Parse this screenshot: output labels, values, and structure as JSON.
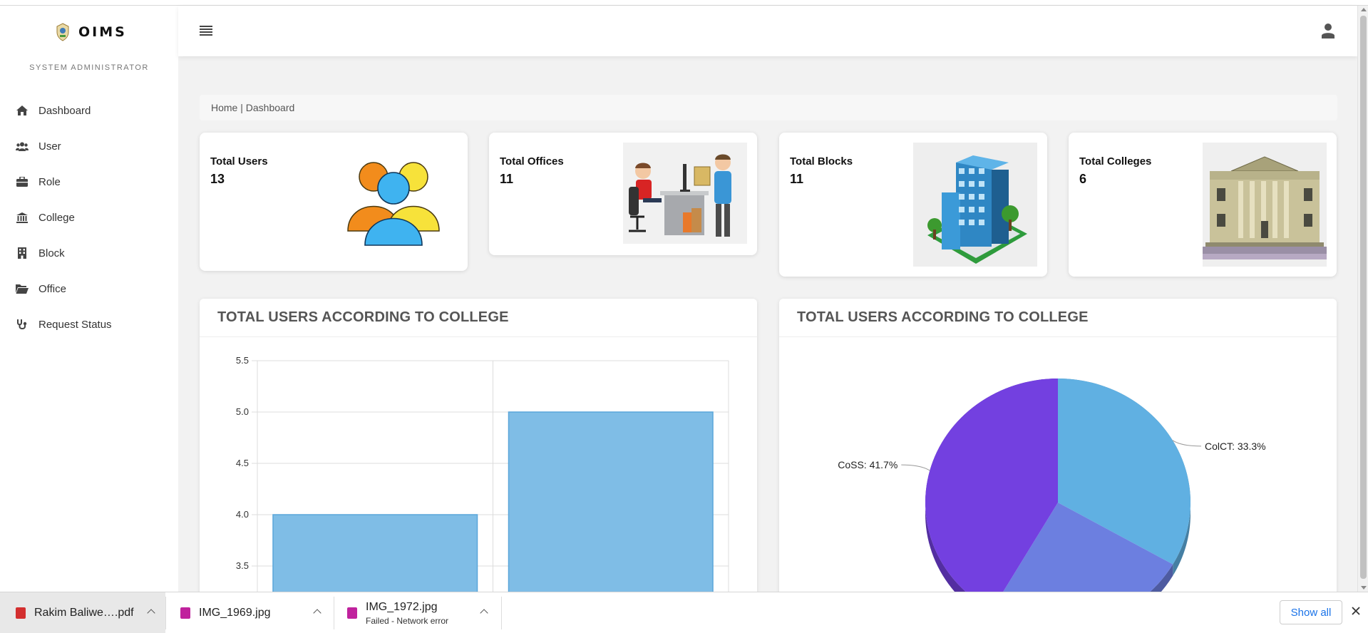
{
  "app": {
    "brand": "OIMS",
    "role_caption": "SYSTEM ADMINISTRATOR"
  },
  "sidebar": {
    "items": [
      {
        "label": "Dashboard",
        "icon": "home-icon"
      },
      {
        "label": "User",
        "icon": "users-icon"
      },
      {
        "label": "Role",
        "icon": "briefcase-icon"
      },
      {
        "label": "College",
        "icon": "bank-icon"
      },
      {
        "label": "Block",
        "icon": "building-icon"
      },
      {
        "label": "Office",
        "icon": "folder-open-icon"
      },
      {
        "label": "Request Status",
        "icon": "stethoscope-icon"
      }
    ]
  },
  "breadcrumb": {
    "home": "Home",
    "separator": " | ",
    "current": "Dashboard"
  },
  "stats": [
    {
      "title": "Total Users",
      "value": "13",
      "image": "users-group-illustration"
    },
    {
      "title": "Total Offices",
      "value": "11",
      "image": "office-workers-illustration"
    },
    {
      "title": "Total Blocks",
      "value": "11",
      "image": "building-block-illustration"
    },
    {
      "title": "Total Colleges",
      "value": "6",
      "image": "college-building-illustration"
    }
  ],
  "panels": {
    "bar_title": "TOTAL USERS ACCORDING TO COLLEGE",
    "pie_title": "TOTAL USERS ACCORDING TO COLLEGE"
  },
  "chart_data": [
    {
      "type": "bar",
      "title": "TOTAL USERS ACCORDING TO COLLEGE",
      "categories": [
        "",
        ""
      ],
      "values": [
        4,
        5
      ],
      "ylim": [
        3.3,
        5.5
      ],
      "yticks": [
        3.5,
        4.0,
        4.5,
        5.0,
        5.5
      ],
      "ytick_labels": [
        "3.5",
        "4.0",
        "4.5",
        "5.0",
        "5.5"
      ],
      "grid": true,
      "color": "#7fbde6"
    },
    {
      "type": "pie",
      "title": "TOTAL USERS ACCORDING TO COLLEGE",
      "slices": [
        {
          "label": "ColCT: 33.3%",
          "value": 33.3,
          "color": "#60b0e2"
        },
        {
          "label": "",
          "value": 25.0,
          "color": "#6c7fe0"
        },
        {
          "label": "CoSS: 41.7%",
          "value": 41.7,
          "color": "#7340e0"
        }
      ]
    }
  ],
  "downloads": {
    "items": [
      {
        "name": "Rakim Baliwe….pdf",
        "status": "",
        "icon": "pdf-file-icon",
        "color": "#d32f2f"
      },
      {
        "name": "IMG_1969.jpg",
        "status": "",
        "icon": "image-file-icon",
        "color": "#c0229d"
      },
      {
        "name": "IMG_1972.jpg",
        "status": "Failed - Network error",
        "icon": "image-file-icon",
        "color": "#c0229d"
      }
    ],
    "show_all": "Show all"
  },
  "colors": {
    "accent": "#1a73e8",
    "sidebar_bg": "#ffffff",
    "page_bg": "#f2f2f2"
  }
}
